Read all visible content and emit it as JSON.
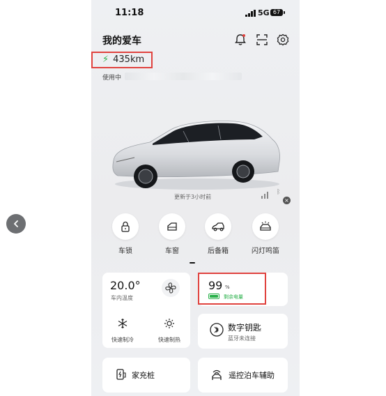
{
  "status_bar": {
    "time": "11:18",
    "network": "5G",
    "battery": "67"
  },
  "header": {
    "title": "我的爱车"
  },
  "range": {
    "value": "435km"
  },
  "vehicle": {
    "using_label": "使用中",
    "updated": "更新于3小时前"
  },
  "quick_actions": [
    {
      "label": "车锁",
      "icon": "lock-icon"
    },
    {
      "label": "车窗",
      "icon": "window-icon"
    },
    {
      "label": "后备箱",
      "icon": "trunk-icon"
    },
    {
      "label": "闪灯鸣笛",
      "icon": "flash-horn-icon"
    }
  ],
  "climate": {
    "temperature": "20.0°",
    "temperature_label": "车内温度",
    "cool_label": "快速制冷",
    "heat_label": "快速制热"
  },
  "battery_card": {
    "percent": "99",
    "unit": "%",
    "label": "剩余电量",
    "level": 0.99,
    "color": "#2ab14a"
  },
  "digital_key": {
    "title": "数字钥匙",
    "subtitle": "蓝牙未连接"
  },
  "home_charger": {
    "label": "家充桩"
  },
  "remote_parking": {
    "label": "遥控泊车辅助"
  },
  "colors": {
    "highlight": "#e0423e",
    "accent_green": "#2ab14a"
  }
}
